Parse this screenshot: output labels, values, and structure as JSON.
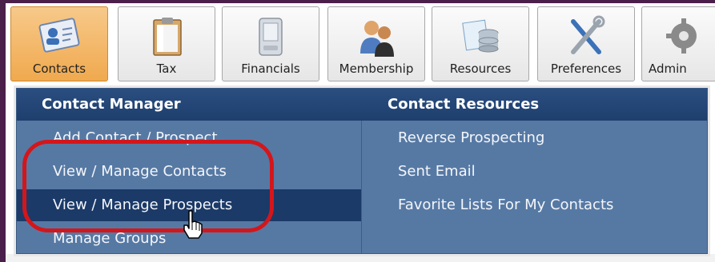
{
  "tabs": [
    {
      "label": "Contacts",
      "icon": "contact-card-icon",
      "active": true
    },
    {
      "label": "Tax",
      "icon": "clipboard-icon"
    },
    {
      "label": "Financials",
      "icon": "calculator-icon"
    },
    {
      "label": "Membership",
      "icon": "people-icon"
    },
    {
      "label": "Resources",
      "icon": "database-icon"
    },
    {
      "label": "Preferences",
      "icon": "tools-icon"
    },
    {
      "label": "Admin",
      "icon": "gear-icon"
    }
  ],
  "menu": {
    "left_title": "Contact Manager",
    "right_title": "Contact Resources",
    "left_items": [
      "Add Contact / Prospect",
      "View / Manage Contacts",
      "View / Manage Prospects",
      "Manage Groups"
    ],
    "right_items": [
      "Reverse Prospecting",
      "Sent Email",
      "Favorite Lists For My Contacts"
    ],
    "highlighted": "View / Manage Prospects"
  },
  "colors": {
    "menu_bg": "#5679a4",
    "menu_header": "#1e3f6e",
    "highlight": "#1b3a68",
    "annotation_circle": "#d4161b",
    "active_tab": "#f0a94e"
  }
}
